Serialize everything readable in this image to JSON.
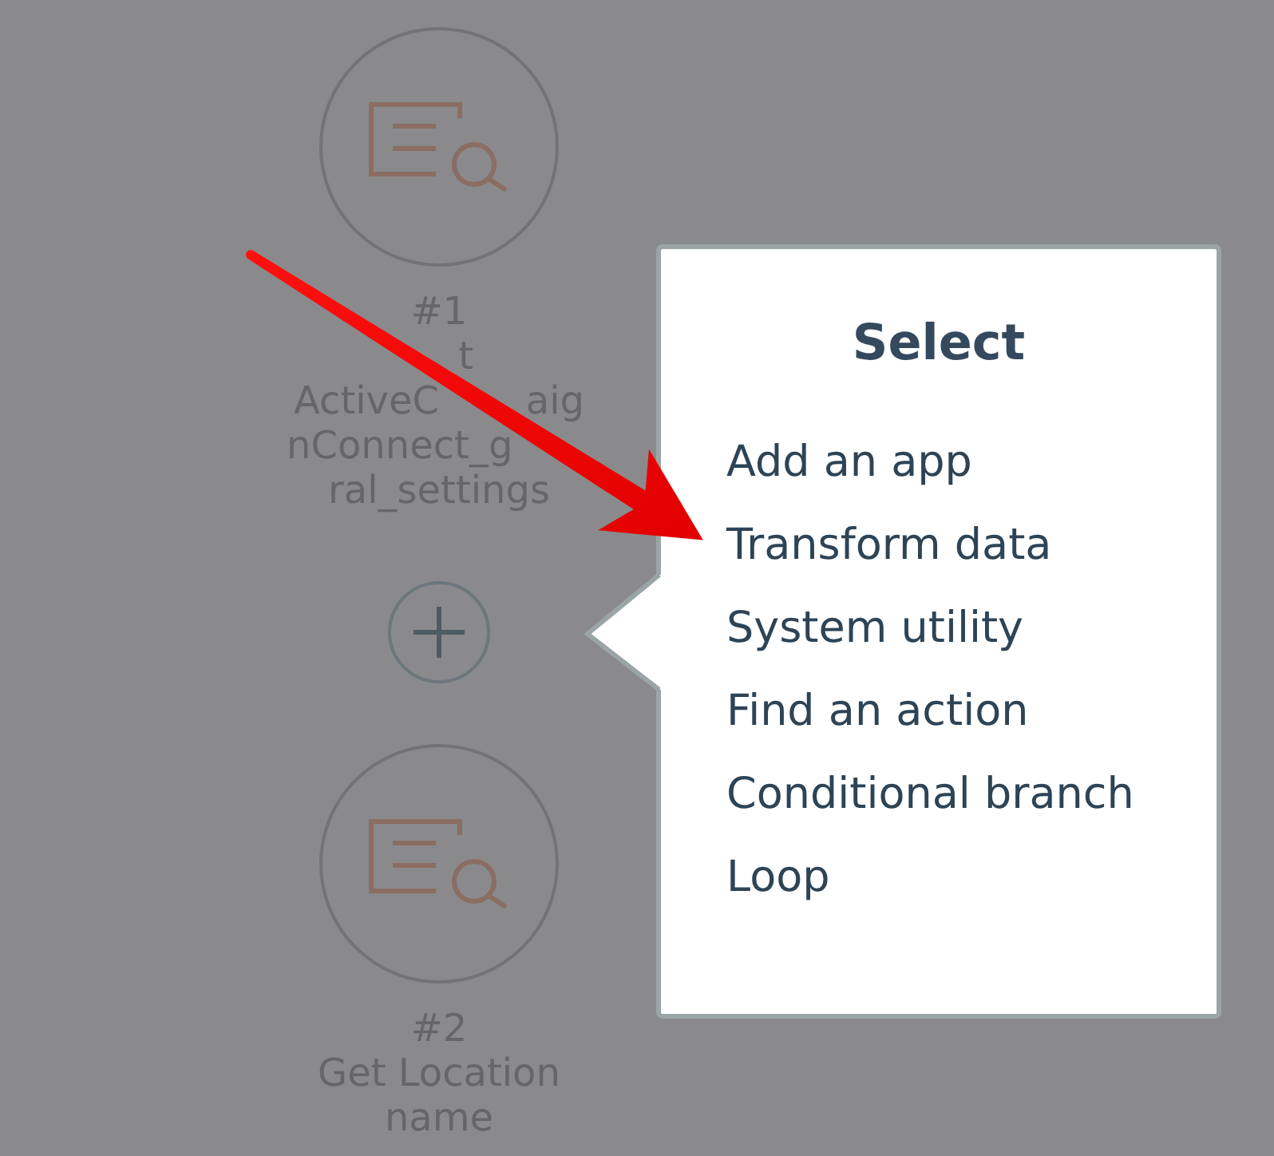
{
  "workflow": {
    "steps": [
      {
        "number": "#1",
        "title_lines": [
          [
            "t"
          ],
          [
            "ActiveC",
            "aig"
          ],
          [
            "nConnect_g"
          ],
          [
            "ral_settings"
          ]
        ]
      },
      {
        "number": "#2",
        "title": "Get Location name"
      }
    ]
  },
  "popover": {
    "title": "Select",
    "items": [
      "Add an app",
      "Transform data",
      "System utility",
      "Find an action",
      "Conditional branch",
      "Loop"
    ]
  }
}
